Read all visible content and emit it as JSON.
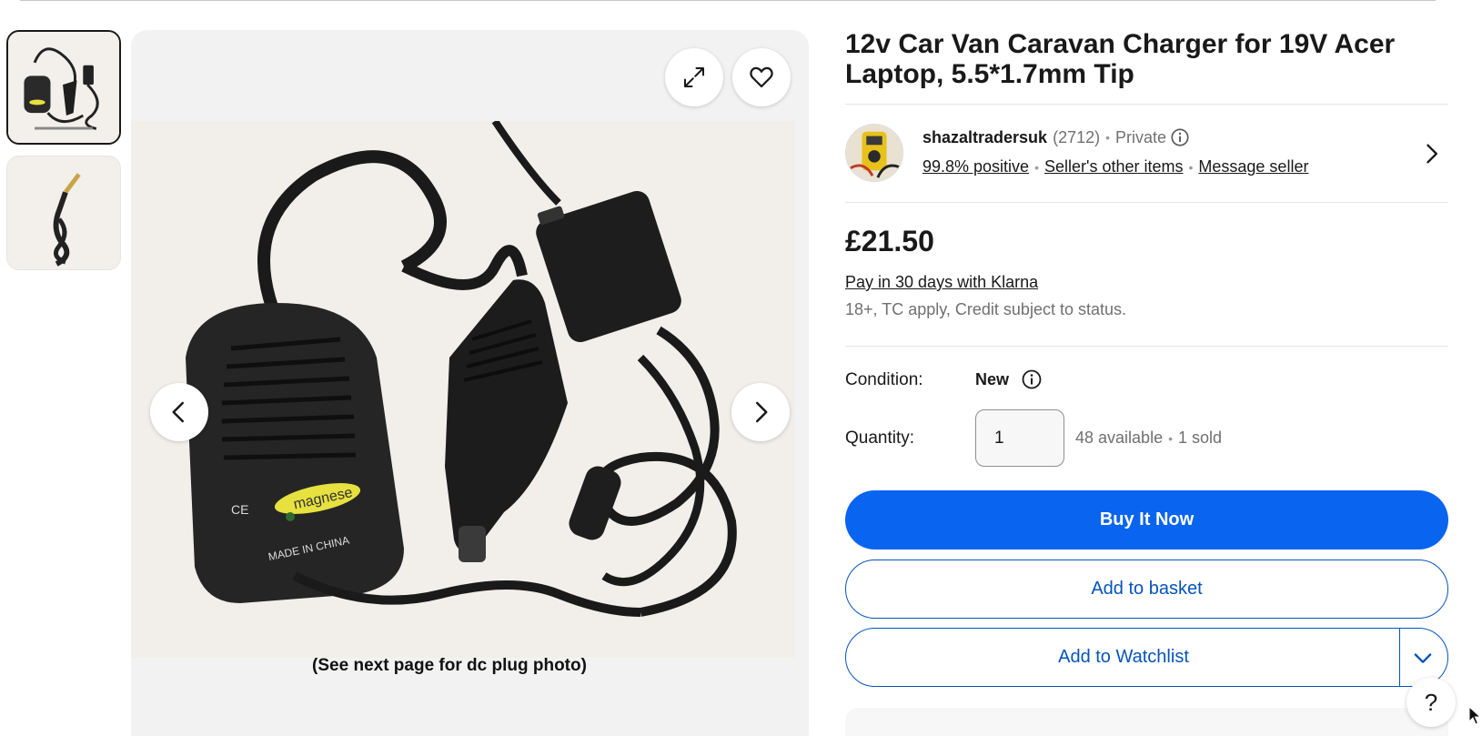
{
  "listing": {
    "title": "12v Car Van Caravan Charger for 19V Acer Laptop, 5.5*1.7mm Tip",
    "image_caption": "(See next page for dc plug photo)"
  },
  "gallery": {
    "thumbnail_count": 2,
    "selected_thumbnail": 1,
    "controls": [
      "expand-icon",
      "heart-icon",
      "chevron-left-icon",
      "chevron-right-icon"
    ]
  },
  "seller": {
    "name": "shazaltradersuk",
    "feedback_count": "(2712)",
    "type": "Private",
    "positive": "99.8% positive",
    "other_items": "Seller's other items",
    "message": "Message seller"
  },
  "price": {
    "amount": "£21.50",
    "klarna_link": "Pay in 30 days with Klarna",
    "klarna_note": "18+, TC apply, Credit subject to status."
  },
  "condition": {
    "label": "Condition:",
    "value": "New"
  },
  "quantity": {
    "label": "Quantity:",
    "value": "1",
    "available": "48 available",
    "sold": "1 sold"
  },
  "actions": {
    "buy_now": "Buy It Now",
    "add_to_basket": "Add to basket",
    "add_to_watchlist": "Add to Watchlist"
  },
  "help": {
    "label": "?"
  },
  "colors": {
    "primary_blue": "#0964f0",
    "link_blue": "#0654ba",
    "text": "#191919",
    "muted": "#707070"
  }
}
